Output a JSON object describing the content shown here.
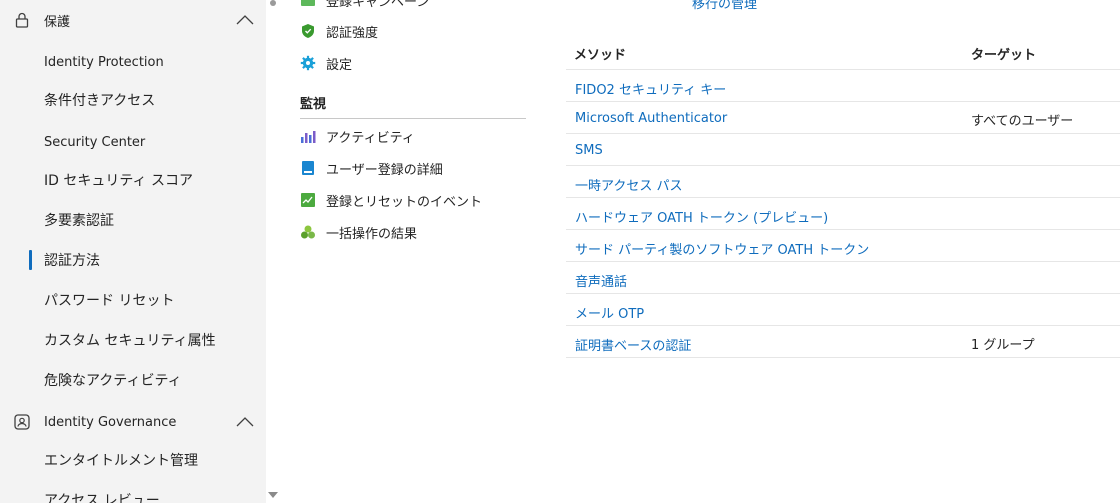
{
  "left_nav": {
    "sections": [
      {
        "label": "保護",
        "icon": "lock-icon",
        "expanded": true
      },
      {
        "label": "Identity Governance",
        "icon": "identity-governance-icon",
        "expanded": true
      }
    ],
    "protection_items": [
      "Identity Protection",
      "条件付きアクセス",
      "Security Center",
      "ID セキュリティ スコア",
      "多要素認証",
      "認証方法",
      "パスワード リセット",
      "カスタム セキュリティ属性",
      "危険なアクティビティ"
    ],
    "governance_items": [
      "エンタイトルメント管理",
      "アクセス レビュー"
    ],
    "selected": "認証方法"
  },
  "middle_menu": {
    "partial_top_item": "登録キャンペーン",
    "items": [
      {
        "label": "認証強度",
        "icon": "shield-icon"
      },
      {
        "label": "設定",
        "icon": "gear-icon"
      }
    ],
    "monitoring_heading": "監視",
    "monitoring_items": [
      {
        "label": "アクティビティ",
        "icon": "activity-chart-icon"
      },
      {
        "label": "ユーザー登録の詳細",
        "icon": "registration-details-icon"
      },
      {
        "label": "登録とリセットのイベント",
        "icon": "events-icon"
      },
      {
        "label": "一括操作の結果",
        "icon": "bulk-results-icon"
      }
    ]
  },
  "content": {
    "top_link": "移行の管理",
    "columns": {
      "method": "メソッド",
      "target": "ターゲット"
    },
    "rows": [
      {
        "method": "FIDO2 セキュリティ キー",
        "target": ""
      },
      {
        "method": "Microsoft Authenticator",
        "target": "すべてのユーザー"
      },
      {
        "method": "SMS",
        "target": ""
      },
      {
        "method": "一時アクセス パス",
        "target": ""
      },
      {
        "method": "ハードウェア OATH トークン (プレビュー)",
        "target": ""
      },
      {
        "method": "サード パーティ製のソフトウェア OATH トークン",
        "target": ""
      },
      {
        "method": "音声通話",
        "target": ""
      },
      {
        "method": "メール OTP",
        "target": ""
      },
      {
        "method": "証明書ベースの認証",
        "target": "1 グループ"
      }
    ]
  },
  "colors": {
    "accent": "#0f6cbd",
    "nav_bg": "#f3f3f3"
  }
}
